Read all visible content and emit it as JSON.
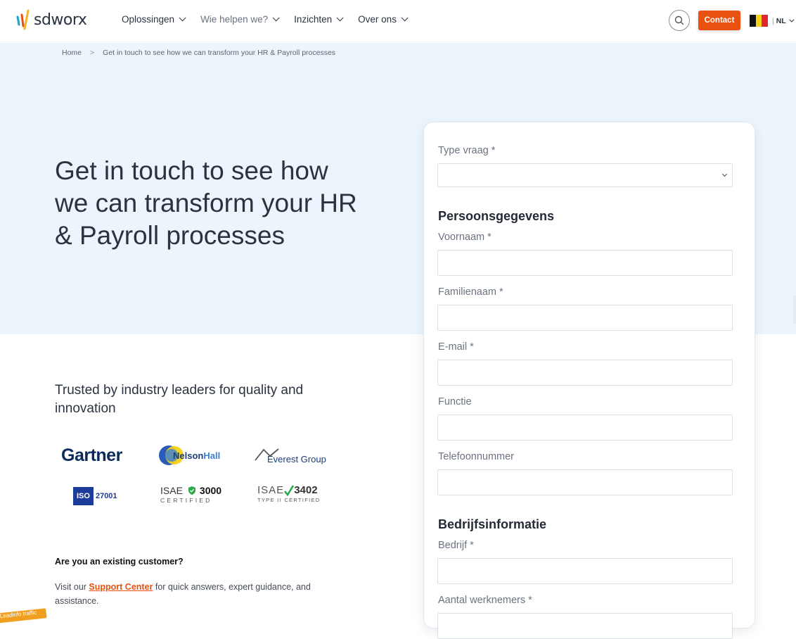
{
  "header": {
    "logo_text": "sdworx",
    "nav": [
      {
        "label": "Oplossingen"
      },
      {
        "label": "Wie helpen we?"
      },
      {
        "label": "Inzichten"
      },
      {
        "label": "Over ons"
      }
    ],
    "search_icon": "search-icon",
    "contact_label": "Contact",
    "language": "NL",
    "language_separator": "|",
    "colors": {
      "accent": "#e8510f",
      "hero_bg": "#edf5fc"
    }
  },
  "breadcrumb": {
    "home": "Home",
    "separator": ">",
    "current": "Get in touch to see how we can transform your HR & Payroll processes"
  },
  "hero": {
    "title": "Get in touch to see how we can transform your HR & Payroll processes"
  },
  "trusted": {
    "heading": "Trusted by industry leaders for quality and innovation",
    "logos": {
      "gartner": "Gartner",
      "nelsonhall_nelson": "Nelson",
      "nelsonhall_hall": "Hall",
      "everest": "Everest Group",
      "iso_badge": "ISO",
      "iso_number": "27001",
      "isae3000_name": "ISAE",
      "isae3000_number": "3000",
      "isae3000_sub": "CERTIFIED",
      "isae3402_name": "ISAE",
      "isae3402_number": "3402",
      "isae3402_sub": "TYPE II CERTIFIED"
    }
  },
  "customer": {
    "question": "Are you an existing customer?",
    "visit_prefix": "Visit our ",
    "support_link": "Support Center",
    "visit_suffix": " for quick answers, expert guidance, and assistance."
  },
  "form": {
    "type_label": "Type vraag *",
    "section_personal": "Persoonsgegevens",
    "first_name_label": "Voornaam *",
    "last_name_label": "Familienaam *",
    "email_label": "E-mail *",
    "function_label": "Functie",
    "phone_label": "Telefoonnummer",
    "section_company": "Bedrijfsinformatie",
    "company_label": "Bedrijf *",
    "employees_label": "Aantal werknemers *"
  },
  "corner_tag": "Leadinfo traffic"
}
